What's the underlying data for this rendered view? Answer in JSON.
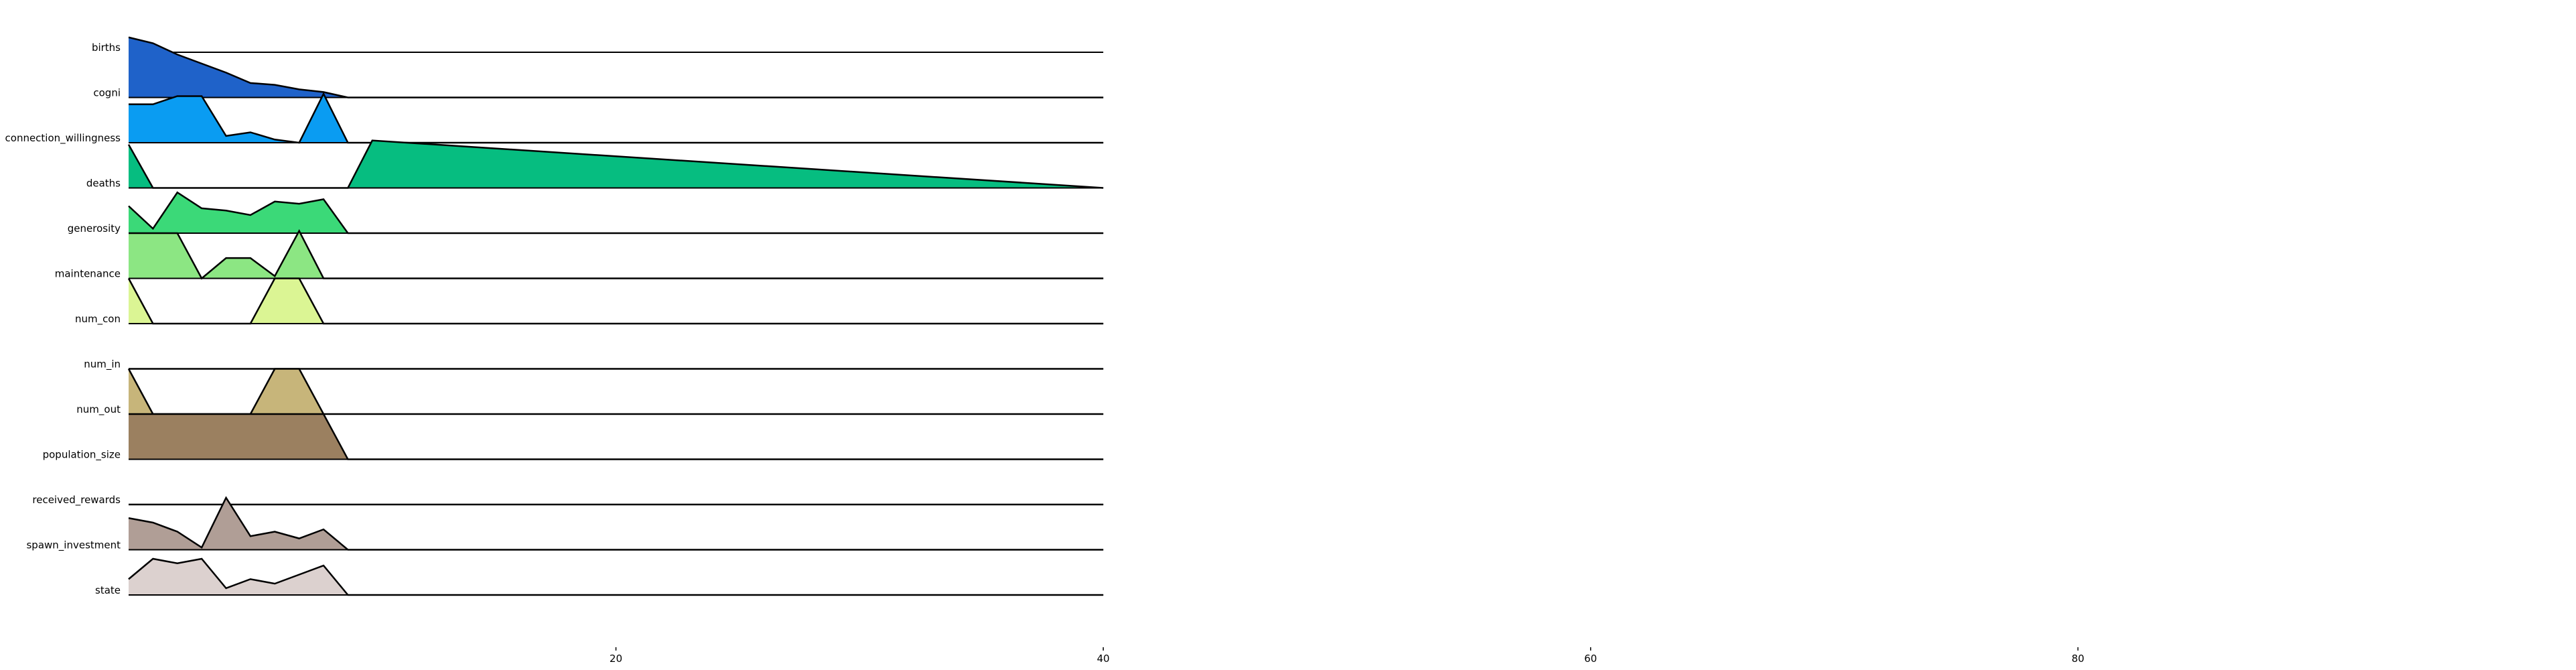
{
  "chart_data": {
    "type": "area",
    "subtype": "ridgeline",
    "x_axis": {
      "lim": [
        0,
        100
      ],
      "ticks": [
        20,
        40,
        60,
        80
      ]
    },
    "rows": [
      {
        "label": "births",
        "color": "#1f62c9",
        "x": [
          0,
          1,
          2,
          3,
          4,
          5,
          6,
          7,
          8,
          9,
          10,
          40
        ],
        "y": [
          0.33,
          0.2,
          -0.05,
          -0.25,
          -0.45,
          -0.68,
          -0.72,
          -0.82,
          -0.88,
          -1.0,
          -1.0,
          -1.0
        ]
      },
      {
        "label": "cogni",
        "color": "#0a9cf2",
        "x": [
          0,
          1,
          2,
          3,
          4,
          5,
          6,
          7,
          8,
          9,
          10,
          40
        ],
        "y": [
          -0.15,
          -0.15,
          0.03,
          0.03,
          -0.85,
          -0.77,
          -0.93,
          -1.0,
          0.08,
          -1.0,
          -1.0,
          -1.0
        ]
      },
      {
        "label": "connection_willingness",
        "color": "#06bd80",
        "x": [
          0,
          1,
          2,
          3,
          4,
          5,
          6,
          7,
          8,
          9,
          10,
          40
        ],
        "y": [
          -0.04,
          -1.0,
          -1.0,
          -1.0,
          -1.0,
          -1.0,
          -1.0,
          -1.0,
          -1.0,
          -1.0,
          0.05,
          -1.0
        ]
      },
      {
        "label": "deaths",
        "color": "#3bd978",
        "x": [
          0,
          1,
          2,
          3,
          4,
          5,
          6,
          7,
          8,
          9,
          10,
          40
        ],
        "y": [
          -0.4,
          -0.9,
          -0.1,
          -0.45,
          -0.5,
          -0.6,
          -0.3,
          -0.35,
          -0.25,
          -1.0,
          -1.0,
          -1.0
        ]
      },
      {
        "label": "generosity",
        "color": "#8ce683",
        "x": [
          0,
          1,
          2,
          3,
          4,
          5,
          6,
          7,
          8,
          9,
          10,
          40
        ],
        "y": [
          0,
          0,
          0,
          -1.0,
          -0.55,
          -0.55,
          -0.95,
          0.05,
          -1.0,
          -1.0,
          -1.0,
          -1.0
        ]
      },
      {
        "label": "maintenance",
        "color": "#dbf594",
        "x": [
          0,
          1,
          2,
          3,
          4,
          5,
          6,
          7,
          8,
          9,
          10,
          40
        ],
        "y": [
          0,
          -1.0,
          -1.0,
          -1.0,
          -1.0,
          -1.0,
          0,
          0,
          -1.0,
          -1.0,
          -1.0,
          -1.0
        ]
      },
      {
        "label": "num_con",
        "color": "#eeeec0",
        "x": [
          0,
          1,
          2,
          3,
          4,
          5,
          6,
          7,
          8,
          9,
          10,
          40
        ],
        "y": [
          -1,
          -1,
          -1,
          -1,
          -1,
          -1,
          -1,
          -1,
          -1,
          -1,
          -1,
          -1
        ]
      },
      {
        "label": "num_in",
        "color": "#c7b57a",
        "x": [
          0,
          1,
          2,
          3,
          4,
          5,
          6,
          7,
          8,
          9,
          10,
          40
        ],
        "y": [
          0,
          -1.0,
          -1.0,
          -1.0,
          -1.0,
          -1.0,
          0,
          0,
          -1.0,
          -1.0,
          -1.0,
          -1.0
        ]
      },
      {
        "label": "num_out",
        "color": "#9b8060",
        "x": [
          0,
          1,
          2,
          3,
          4,
          5,
          6,
          7,
          8,
          9,
          10,
          40
        ],
        "y": [
          0,
          0,
          0,
          0,
          0,
          0,
          0,
          0,
          0,
          -1.0,
          -1.0,
          -1.0
        ]
      },
      {
        "label": "population_size",
        "color": "#b8a08a",
        "x": [
          0,
          1,
          2,
          3,
          4,
          5,
          6,
          7,
          8,
          9,
          10,
          40
        ],
        "y": [
          -1,
          -1,
          -1,
          -1,
          -1,
          -1,
          -1,
          -1,
          -1,
          -1,
          -1,
          -1
        ]
      },
      {
        "label": "received_rewards",
        "color": "#b09e96",
        "x": [
          0,
          1,
          2,
          3,
          4,
          5,
          6,
          7,
          8,
          9,
          10,
          40
        ],
        "y": [
          -0.3,
          -0.4,
          -0.6,
          -0.95,
          0.15,
          -0.7,
          -0.6,
          -0.75,
          -0.55,
          -1.0,
          -1.0,
          -1.0
        ]
      },
      {
        "label": "spawn_investment",
        "color": "#dcd1cf",
        "x": [
          0,
          1,
          2,
          3,
          4,
          5,
          6,
          7,
          8,
          9,
          10,
          40
        ],
        "y": [
          -0.65,
          -0.2,
          -0.3,
          -0.2,
          -0.85,
          -0.65,
          -0.75,
          -0.55,
          -0.35,
          -1.0,
          -1.0,
          -1.0
        ]
      },
      {
        "label": "state",
        "color": "#eeeeee",
        "x": [
          0,
          40
        ],
        "y": [
          -1,
          -1
        ]
      }
    ]
  }
}
